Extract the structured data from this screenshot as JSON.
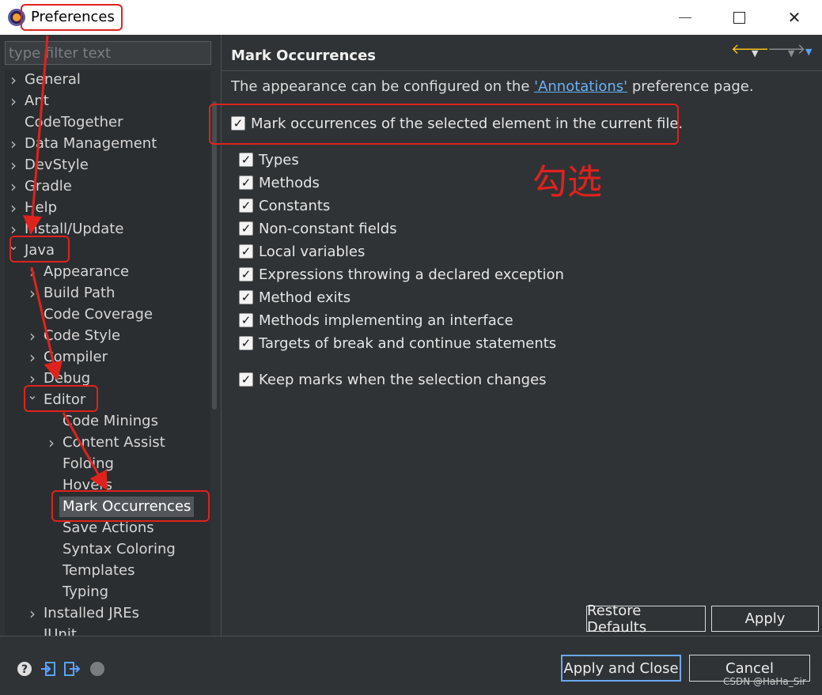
{
  "window": {
    "title": "Preferences"
  },
  "filter": {
    "placeholder": "type filter text"
  },
  "tree": {
    "items": [
      {
        "label": "General",
        "depth": 0,
        "arrow": "collapsed"
      },
      {
        "label": "Ant",
        "depth": 0,
        "arrow": "collapsed"
      },
      {
        "label": "CodeTogether",
        "depth": 0,
        "arrow": "none"
      },
      {
        "label": "Data Management",
        "depth": 0,
        "arrow": "collapsed"
      },
      {
        "label": "DevStyle",
        "depth": 0,
        "arrow": "collapsed"
      },
      {
        "label": "Gradle",
        "depth": 0,
        "arrow": "collapsed"
      },
      {
        "label": "Help",
        "depth": 0,
        "arrow": "collapsed"
      },
      {
        "label": "Install/Update",
        "depth": 0,
        "arrow": "collapsed"
      },
      {
        "label": "Java",
        "depth": 0,
        "arrow": "expanded"
      },
      {
        "label": "Appearance",
        "depth": 1,
        "arrow": "collapsed"
      },
      {
        "label": "Build Path",
        "depth": 1,
        "arrow": "collapsed"
      },
      {
        "label": "Code Coverage",
        "depth": 1,
        "arrow": "none"
      },
      {
        "label": "Code Style",
        "depth": 1,
        "arrow": "collapsed"
      },
      {
        "label": "Compiler",
        "depth": 1,
        "arrow": "collapsed"
      },
      {
        "label": "Debug",
        "depth": 1,
        "arrow": "collapsed"
      },
      {
        "label": "Editor",
        "depth": 1,
        "arrow": "expanded"
      },
      {
        "label": "Code Minings",
        "depth": 2,
        "arrow": "none"
      },
      {
        "label": "Content Assist",
        "depth": 2,
        "arrow": "collapsed"
      },
      {
        "label": "Folding",
        "depth": 2,
        "arrow": "none"
      },
      {
        "label": "Hovers",
        "depth": 2,
        "arrow": "none"
      },
      {
        "label": "Mark Occurrences",
        "depth": 2,
        "arrow": "none",
        "selected": true
      },
      {
        "label": "Save Actions",
        "depth": 2,
        "arrow": "none"
      },
      {
        "label": "Syntax Coloring",
        "depth": 2,
        "arrow": "none"
      },
      {
        "label": "Templates",
        "depth": 2,
        "arrow": "none"
      },
      {
        "label": "Typing",
        "depth": 2,
        "arrow": "none"
      },
      {
        "label": "Installed JREs",
        "depth": 1,
        "arrow": "collapsed"
      },
      {
        "label": "JUnit",
        "depth": 1,
        "arrow": "none"
      }
    ]
  },
  "page": {
    "title": "Mark Occurrences",
    "desc_before": "The appearance can be configured on the ",
    "desc_link": "'Annotations'",
    "desc_after": " preference page.",
    "main_option": "Mark occurrences of the selected element in the current file.",
    "options": [
      {
        "label": "Types",
        "checked": true
      },
      {
        "label": "Methods",
        "checked": true
      },
      {
        "label": "Constants",
        "checked": true
      },
      {
        "label": "Non-constant fields",
        "checked": true
      },
      {
        "label": "Local variables",
        "checked": true
      },
      {
        "label": "Expressions throwing a declared exception",
        "checked": true
      },
      {
        "label": "Method exits",
        "checked": true
      },
      {
        "label": "Methods implementing an interface",
        "checked": true
      },
      {
        "label": "Targets of break and continue statements",
        "checked": true
      }
    ],
    "keep_marks": "Keep marks when the selection changes",
    "annotation_text": "勾选"
  },
  "buttons": {
    "restore_defaults": "Restore Defaults",
    "apply": "Apply",
    "apply_and_close": "Apply and Close",
    "cancel": "Cancel"
  },
  "watermark": "CSDN @HaHa_Sir",
  "colors": {
    "background": "#2f3336",
    "annotation_red": "#e0221d",
    "link_blue": "#6ab0f3",
    "primary_button_border": "#6aa7f8"
  }
}
